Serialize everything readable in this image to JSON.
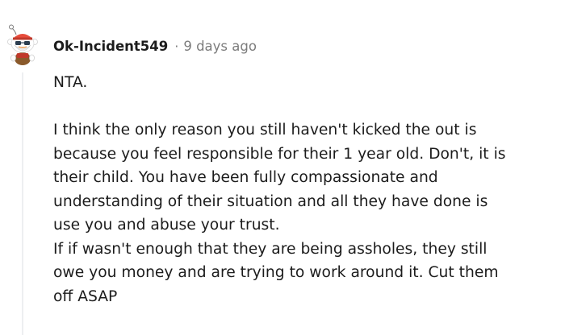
{
  "comment": {
    "author": "Ok-Incident549",
    "separator": "·",
    "timestamp": "9 days ago",
    "avatar_icon": "snoo-avatar-icon",
    "lines_first": "NTA.",
    "lines_body": [
      "I think the only reason you still haven't kicked the out is",
      "because you feel responsible for their 1 year old. Don't, it is",
      "their child. You have been fully compassionate and",
      "understanding of their situation and all they have done is",
      "use you and abuse your trust.",
      "If if wasn't enough that they are being assholes, they still",
      "owe you money and are trying to work around it. Cut them",
      "off ASAP"
    ]
  },
  "colors": {
    "text": "#1c1c1c",
    "meta": "#7c7c7c",
    "thread_line": "#edeff1"
  }
}
